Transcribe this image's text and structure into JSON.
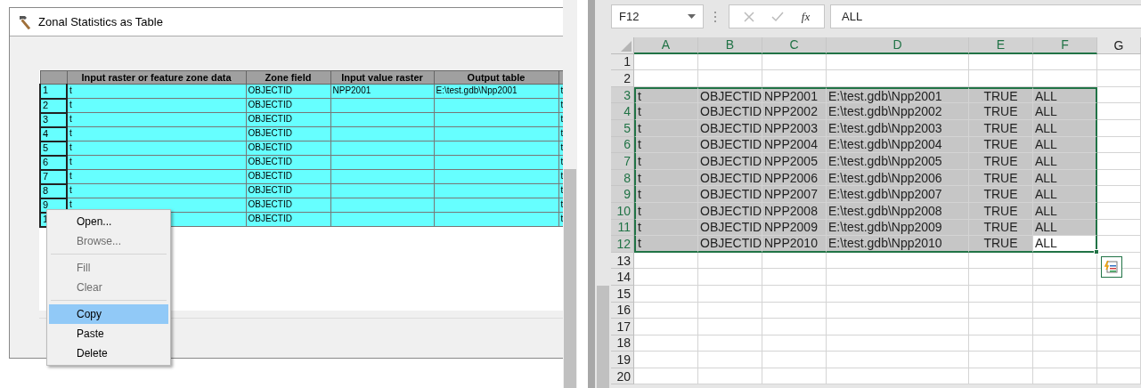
{
  "dialog": {
    "title": "Zonal Statistics as Table",
    "columns": [
      "Input raster or feature zone data",
      "Zone field",
      "Input value raster",
      "Output table"
    ],
    "rows": [
      {
        "number": "1",
        "zone_data": "t",
        "zone_field": "OBJECTID",
        "value_raster": "NPP2001",
        "output_table": "E:\\test.gdb\\Npp2001",
        "column_5": "t"
      },
      {
        "number": "2",
        "zone_data": "t",
        "zone_field": "OBJECTID",
        "column_5": "t"
      },
      {
        "number": "3",
        "zone_data": "t",
        "zone_field": "OBJECTID",
        "column_5": "t"
      },
      {
        "number": "4",
        "zone_data": "t",
        "zone_field": "OBJECTID",
        "column_5": "t"
      },
      {
        "number": "5",
        "zone_data": "t",
        "zone_field": "OBJECTID",
        "column_5": "t"
      },
      {
        "number": "6",
        "zone_data": "t",
        "zone_field": "OBJECTID",
        "column_5": "t"
      },
      {
        "number": "7",
        "zone_data": "t",
        "zone_field": "OBJECTID",
        "column_5": "t"
      },
      {
        "number": "8",
        "zone_data": "t",
        "zone_field": "OBJECTID",
        "column_5": "t"
      },
      {
        "number": "9",
        "zone_data": "t",
        "zone_field": "OBJECTID",
        "column_5": "t"
      },
      {
        "number": "1",
        "zone_field": "OBJECTID",
        "column_5": "t"
      }
    ]
  },
  "context_menu": {
    "items": [
      {
        "kind": "item",
        "label": "Open...",
        "disabled": false,
        "selected": false
      },
      {
        "kind": "item",
        "label": "Browse...",
        "disabled": true,
        "selected": false
      },
      {
        "kind": "separator"
      },
      {
        "kind": "item",
        "label": "Fill",
        "disabled": true,
        "selected": false
      },
      {
        "kind": "item",
        "label": "Clear",
        "disabled": true,
        "selected": false
      },
      {
        "kind": "separator"
      },
      {
        "kind": "item",
        "label": "Copy",
        "disabled": false,
        "selected": true
      },
      {
        "kind": "item",
        "label": "Paste",
        "disabled": false,
        "selected": false
      },
      {
        "kind": "item",
        "label": "Delete",
        "disabled": false,
        "selected": false
      }
    ]
  },
  "spreadsheet": {
    "name_box": "F12",
    "fx_label": "fx",
    "formula": "ALL",
    "columns": [
      "A",
      "B",
      "C",
      "D",
      "E",
      "F",
      "G"
    ],
    "rows": [
      {
        "number": "1"
      },
      {
        "number": "2"
      },
      {
        "number": "3",
        "cells": [
          {
            "text": "t",
            "active": false
          },
          {
            "text": "OBJECTID",
            "active": false
          },
          {
            "text": "NPP2001",
            "active": false
          },
          {
            "text": "E:\\test.gdb\\Npp2001",
            "active": false
          },
          {
            "text": "TRUE",
            "active": false
          },
          {
            "text": "ALL",
            "active": false
          }
        ]
      },
      {
        "number": "4",
        "cells": [
          {
            "text": "t",
            "active": false
          },
          {
            "text": "OBJECTID",
            "active": false
          },
          {
            "text": "NPP2002",
            "active": false
          },
          {
            "text": "E:\\test.gdb\\Npp2002",
            "active": false
          },
          {
            "text": "TRUE",
            "active": false
          },
          {
            "text": "ALL",
            "active": false
          }
        ]
      },
      {
        "number": "5",
        "cells": [
          {
            "text": "t",
            "active": false
          },
          {
            "text": "OBJECTID",
            "active": false
          },
          {
            "text": "NPP2003",
            "active": false
          },
          {
            "text": "E:\\test.gdb\\Npp2003",
            "active": false
          },
          {
            "text": "TRUE",
            "active": false
          },
          {
            "text": "ALL",
            "active": false
          }
        ]
      },
      {
        "number": "6",
        "cells": [
          {
            "text": "t",
            "active": false
          },
          {
            "text": "OBJECTID",
            "active": false
          },
          {
            "text": "NPP2004",
            "active": false
          },
          {
            "text": "E:\\test.gdb\\Npp2004",
            "active": false
          },
          {
            "text": "TRUE",
            "active": false
          },
          {
            "text": "ALL",
            "active": false
          }
        ]
      },
      {
        "number": "7",
        "cells": [
          {
            "text": "t",
            "active": false
          },
          {
            "text": "OBJECTID",
            "active": false
          },
          {
            "text": "NPP2005",
            "active": false
          },
          {
            "text": "E:\\test.gdb\\Npp2005",
            "active": false
          },
          {
            "text": "TRUE",
            "active": false
          },
          {
            "text": "ALL",
            "active": false
          }
        ]
      },
      {
        "number": "8",
        "cells": [
          {
            "text": "t",
            "active": false
          },
          {
            "text": "OBJECTID",
            "active": false
          },
          {
            "text": "NPP2006",
            "active": false
          },
          {
            "text": "E:\\test.gdb\\Npp2006",
            "active": false
          },
          {
            "text": "TRUE",
            "active": false
          },
          {
            "text": "ALL",
            "active": false
          }
        ]
      },
      {
        "number": "9",
        "cells": [
          {
            "text": "t",
            "active": false
          },
          {
            "text": "OBJECTID",
            "active": false
          },
          {
            "text": "NPP2007",
            "active": false
          },
          {
            "text": "E:\\test.gdb\\Npp2007",
            "active": false
          },
          {
            "text": "TRUE",
            "active": false
          },
          {
            "text": "ALL",
            "active": false
          }
        ]
      },
      {
        "number": "10",
        "cells": [
          {
            "text": "t",
            "active": false
          },
          {
            "text": "OBJECTID",
            "active": false
          },
          {
            "text": "NPP2008",
            "active": false
          },
          {
            "text": "E:\\test.gdb\\Npp2008",
            "active": false
          },
          {
            "text": "TRUE",
            "active": false
          },
          {
            "text": "ALL",
            "active": false
          }
        ]
      },
      {
        "number": "11",
        "cells": [
          {
            "text": "t",
            "active": false
          },
          {
            "text": "OBJECTID",
            "active": false
          },
          {
            "text": "NPP2009",
            "active": false
          },
          {
            "text": "E:\\test.gdb\\Npp2009",
            "active": false
          },
          {
            "text": "TRUE",
            "active": false
          },
          {
            "text": "ALL",
            "active": false
          }
        ]
      },
      {
        "number": "12",
        "cells": [
          {
            "text": "t",
            "active": false
          },
          {
            "text": "OBJECTID",
            "active": false
          },
          {
            "text": "NPP2010",
            "active": false
          },
          {
            "text": "E:\\test.gdb\\Npp2010",
            "active": false
          },
          {
            "text": "TRUE",
            "active": false
          },
          {
            "text": "ALL",
            "active": true
          }
        ]
      },
      {
        "number": "13"
      },
      {
        "number": "14"
      },
      {
        "number": "15"
      },
      {
        "number": "16"
      },
      {
        "number": "17"
      },
      {
        "number": "18"
      },
      {
        "number": "19"
      },
      {
        "number": "20"
      }
    ]
  }
}
